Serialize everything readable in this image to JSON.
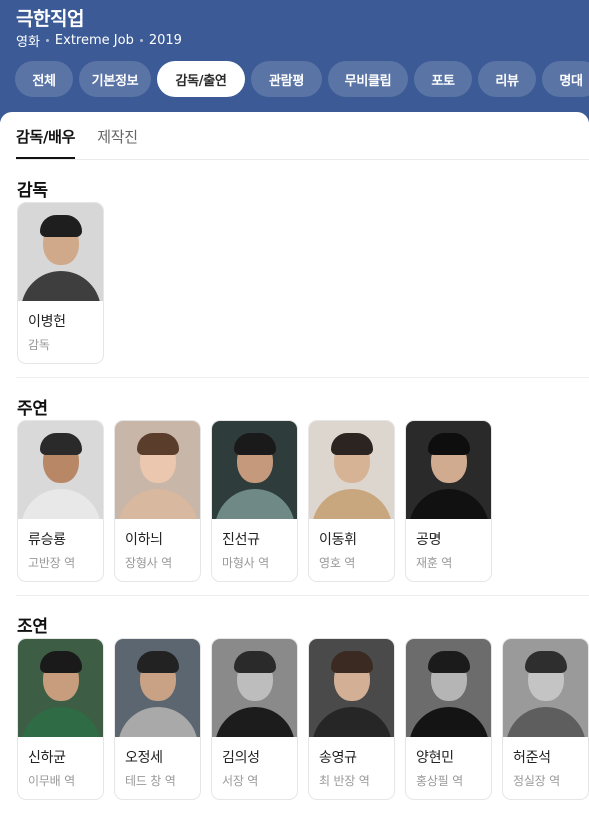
{
  "header": {
    "title": "극한직업",
    "meta": [
      "영화",
      "Extreme Job",
      "2019"
    ],
    "tabs": [
      "전체",
      "기본정보",
      "감독/출연",
      "관람평",
      "무비클립",
      "포토",
      "리뷰",
      "명대"
    ],
    "active_tab": "감독/출연"
  },
  "subtabs": {
    "items": [
      "감독/배우",
      "제작진"
    ],
    "active": "감독/배우"
  },
  "sections": {
    "director": {
      "title": "감독",
      "people": [
        {
          "name": "이병헌",
          "role": "감독",
          "icon": "person-photo"
        }
      ]
    },
    "lead": {
      "title": "주연",
      "people": [
        {
          "name": "류승룡",
          "role": "고반장 역"
        },
        {
          "name": "이하늬",
          "role": "장형사 역"
        },
        {
          "name": "진선규",
          "role": "마형사 역"
        },
        {
          "name": "이동휘",
          "role": "영호 역"
        },
        {
          "name": "공명",
          "role": "재훈 역"
        }
      ]
    },
    "support": {
      "title": "조연",
      "people": [
        {
          "name": "신하균",
          "role": "이무배 역"
        },
        {
          "name": "오정세",
          "role": "테드 창 역"
        },
        {
          "name": "김의성",
          "role": "서장 역"
        },
        {
          "name": "송영규",
          "role": "최 반장 역"
        },
        {
          "name": "양현민",
          "role": "홍상필 역"
        },
        {
          "name": "허준석",
          "role": "정실장 역"
        }
      ]
    }
  },
  "colors": {
    "header_bg": "#3b5a96",
    "chip_bg": "rgba(255,255,255,0.16)",
    "active_chip_bg": "#ffffff"
  }
}
